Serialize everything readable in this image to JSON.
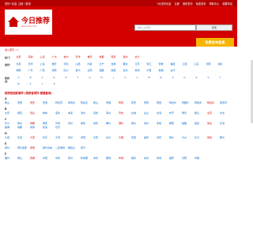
{
  "topbar": {
    "left": "您好! 欢迎, 注册 / 登录",
    "right_items": [
      "0元发布信息",
      "注册",
      "我的发布",
      "免费发布",
      "帮助中心",
      "收藏本站"
    ]
  },
  "logo": {
    "title": "今日推荐",
    "sub": "www.xxxx.com"
  },
  "search": {
    "placeholder": "请输入关键字",
    "button": "搜索"
  },
  "post_button": "免费发布信息",
  "breadcrumb": "进入首页 >>",
  "rows": [
    {
      "label": "热门:",
      "items": [
        "北京",
        "深圳",
        "上海",
        "广州",
        "杭州",
        "天津",
        "重庆",
        "成都",
        "南京",
        "郑州",
        "长沙"
      ],
      "color": "red"
    },
    {
      "label": "省份:",
      "items": [
        "北京",
        "天津",
        "上海",
        "重庆",
        "河北",
        "山西",
        "内蒙",
        "辽宁",
        "吉林",
        "黑龙",
        "江苏",
        "浙江",
        "安徽",
        "福建",
        "江西",
        "山东",
        "河南",
        "湖北",
        "湖南",
        "广东",
        "广西",
        "海南",
        "四川",
        "贵州",
        "云南",
        "西藏",
        "陕西",
        "甘肃",
        "青海",
        "宁夏",
        "新疆",
        "台湾"
      ],
      "color": "blue"
    },
    {
      "label": "按拼音:",
      "items": [
        "A",
        "B",
        "C",
        "D",
        "E",
        "F",
        "G",
        "H",
        "J",
        "K",
        "L",
        "M",
        "N",
        "P",
        "Q",
        "R",
        "S",
        "T",
        "W",
        "X",
        "Y",
        "Z"
      ],
      "color": "blue"
    }
  ],
  "section_title": "按拼音选取城市 (按拼音排列 便捷查询)",
  "regions": [
    {
      "letter": "A",
      "cities": [
        "鞍山",
        "安阳",
        "安庆",
        "安康",
        "阿克苏",
        "阿勒泰",
        "阿拉善",
        "鞍山",
        "安顺",
        "阿坝",
        "安庆",
        "安阳",
        "阿里",
        "阿拉尔",
        "阿图什",
        "阿勒泰",
        "阿拉善",
        "阿克苏"
      ]
    },
    {
      "letter": "B",
      "cities": [
        "北京",
        "保定",
        "包头",
        "蚌埠",
        "宝鸡",
        "本溪",
        "滨州",
        "百色",
        "亳州",
        "巴中",
        "白城",
        "白山",
        "北海",
        "毕节",
        "博乐",
        "保山",
        "北京",
        "北屯"
      ]
    },
    {
      "letter": "C",
      "cities": [
        "长沙",
        "常州",
        "成都",
        "重庆",
        "长春",
        "沧州",
        "承德",
        "常德",
        "郴州",
        "潮州",
        "滁州",
        "池州",
        "赤峰",
        "朝阳",
        "楚雄",
        "昌吉",
        "崇左",
        "长治",
        "巢湖",
        "成都",
        "常熟",
        "慈溪",
        "长乐"
      ]
    },
    {
      "letter": "D",
      "cities": [
        "大连",
        "东莞",
        "大庆",
        "丹东",
        "大同",
        "德州",
        "德阳",
        "东营",
        "达州",
        "大理",
        "定西",
        "迪庆",
        "德宏",
        "儋州",
        "大兴",
        "东方",
        "敦煌",
        "都匀"
      ]
    },
    {
      "letter": "E",
      "cities": [
        "鄂州",
        "鄂尔多斯",
        "恩施",
        "额尔古纳",
        "二连浩特",
        "峨眉山",
        "恩平"
      ]
    },
    {
      "letter": "F",
      "cities": [
        "福州",
        "佛山",
        "抚顺",
        "阜阳",
        "阜新",
        "抚州",
        "防城港",
        "奉化",
        "肥城",
        "丰城",
        "福清",
        "扶余",
        "凤城",
        "福安",
        "汾阳",
        "丰镇"
      ]
    }
  ]
}
